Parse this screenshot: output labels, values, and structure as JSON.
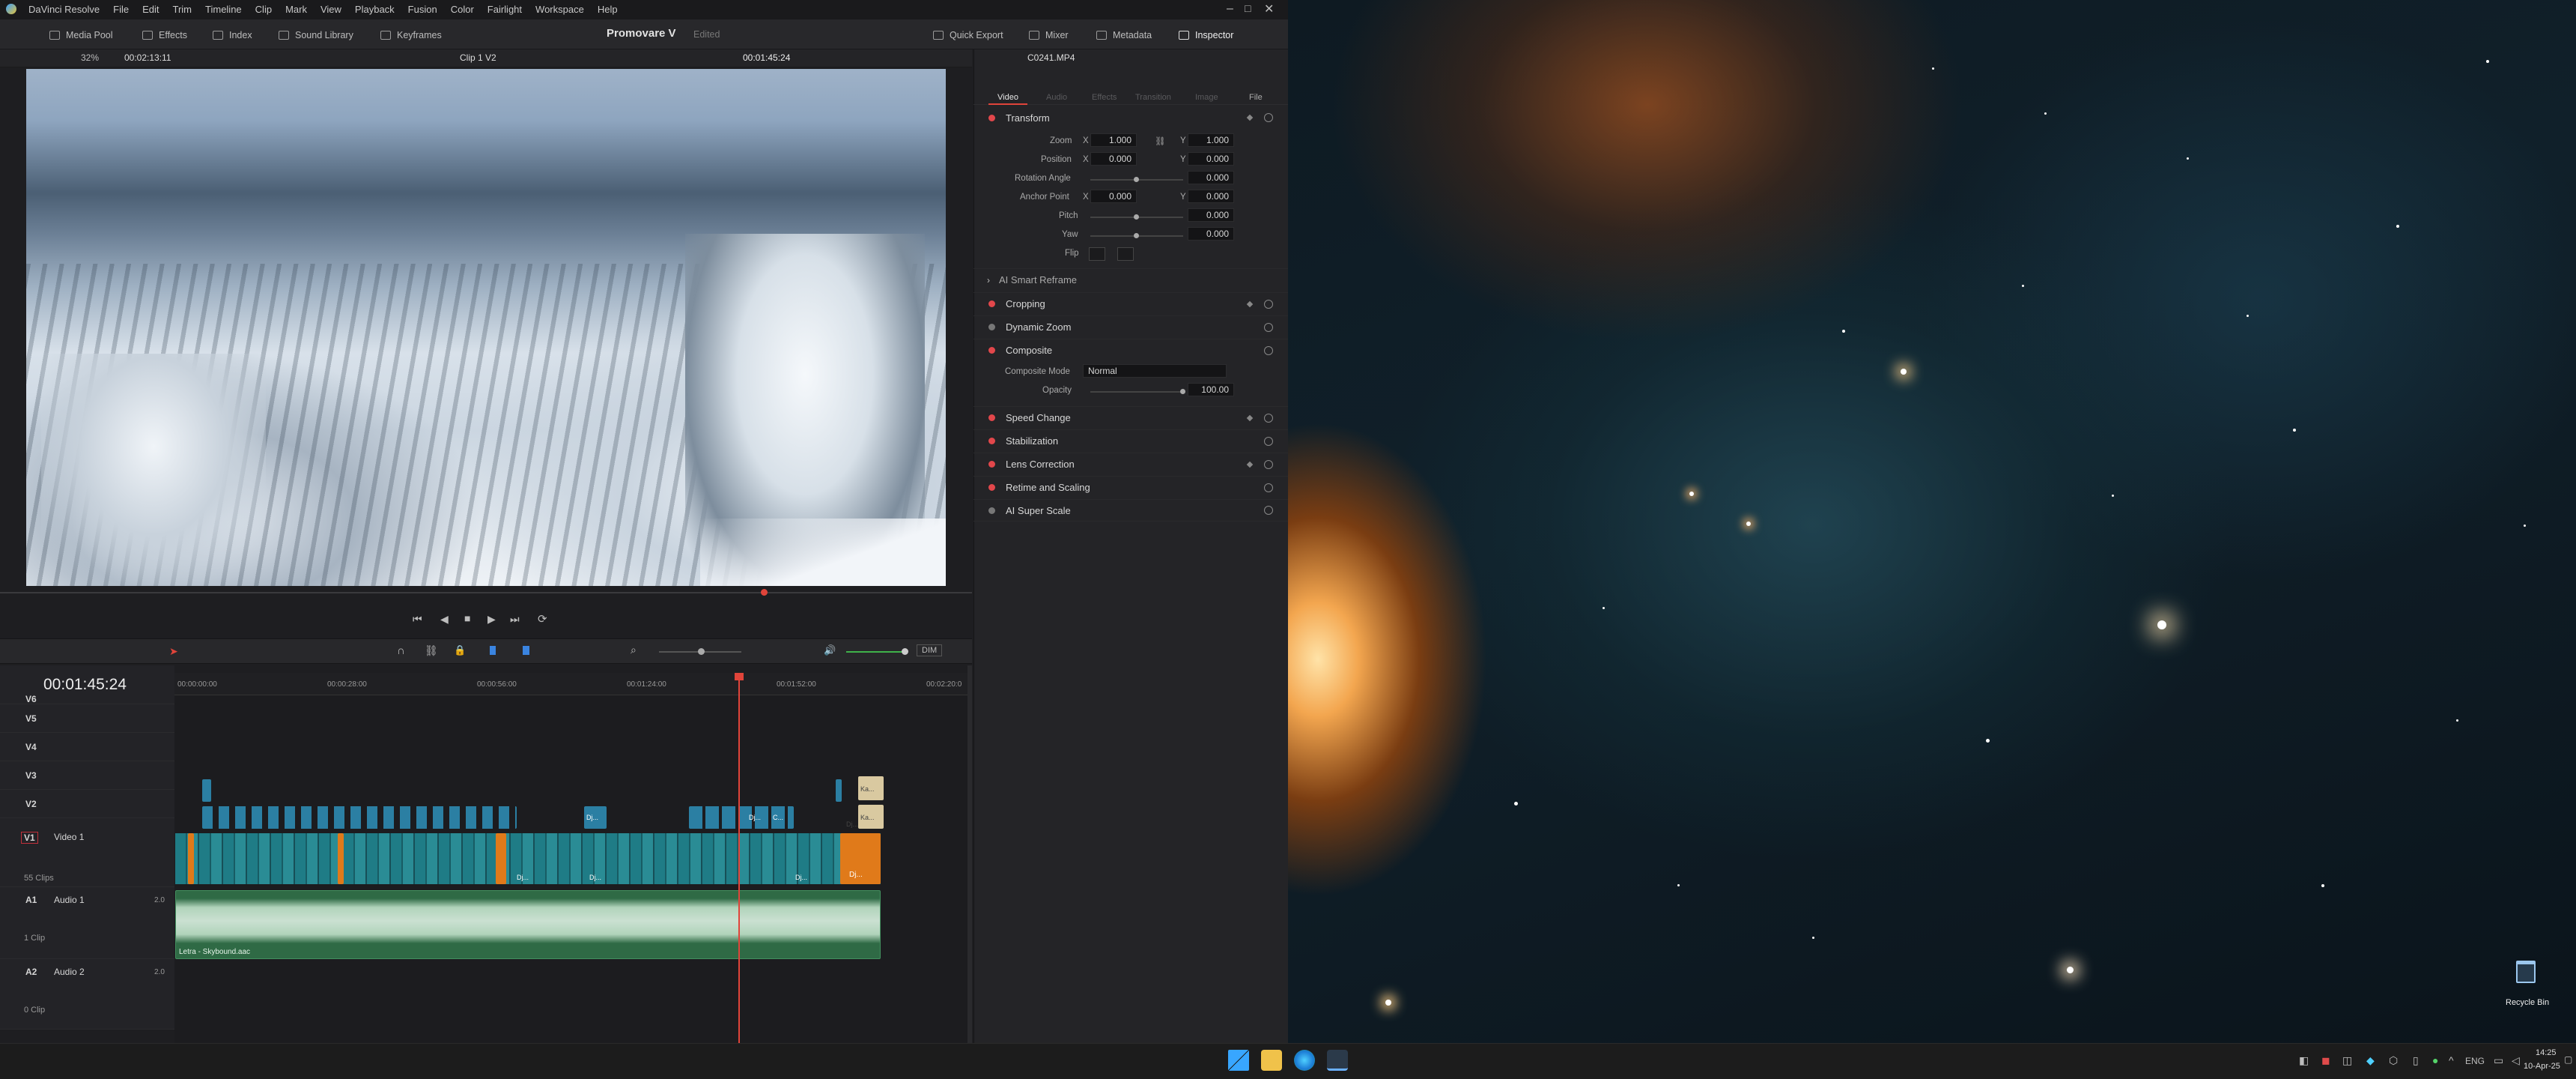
{
  "app": {
    "name": "DaVinci Resolve",
    "menu": [
      "File",
      "Edit",
      "Trim",
      "Timeline",
      "Clip",
      "Mark",
      "View",
      "Playback",
      "Fusion",
      "Color",
      "Fairlight",
      "Workspace",
      "Help"
    ]
  },
  "toolbar": {
    "media_pool": "Media Pool",
    "effects": "Effects",
    "index": "Index",
    "sound_library": "Sound Library",
    "keyframes": "Keyframes",
    "project_name": "Promovare V",
    "project_status": "Edited",
    "quick_export": "Quick Export",
    "mixer": "Mixer",
    "metadata": "Metadata",
    "inspector": "Inspector"
  },
  "viewer": {
    "zoom": "32%",
    "source_tc": "00:02:13:11",
    "clip_label": "Clip 1 V2",
    "timecode": "00:01:45:24"
  },
  "inspector": {
    "clip_name": "C0241.MP4",
    "tabs": [
      "Video",
      "Audio",
      "Effects",
      "Transition",
      "Image",
      "File"
    ],
    "transform": {
      "title": "Transform",
      "zoom_label": "Zoom",
      "zoom_x": "1.000",
      "zoom_y": "1.000",
      "position_label": "Position",
      "pos_x": "0.000",
      "pos_y": "0.000",
      "rotation_label": "Rotation Angle",
      "rotation": "0.000",
      "anchor_label": "Anchor Point",
      "anchor_x": "0.000",
      "anchor_y": "0.000",
      "pitch_label": "Pitch",
      "pitch": "0.000",
      "yaw_label": "Yaw",
      "yaw": "0.000",
      "flip_label": "Flip",
      "x": "X",
      "y": "Y"
    },
    "ai_smart_reframe": "AI Smart Reframe",
    "sections": [
      "Cropping",
      "Dynamic Zoom",
      "Composite"
    ],
    "composite": {
      "mode_label": "Composite Mode",
      "mode": "Normal",
      "opacity_label": "Opacity",
      "opacity": "100.00"
    },
    "sections2": [
      "Speed Change",
      "Stabilization",
      "Lens Correction",
      "Retime and Scaling",
      "AI Super Scale"
    ]
  },
  "timeline": {
    "timecode": "00:01:45:24",
    "dim": "DIM",
    "ruler": [
      "00:00:00:00",
      "00:00:28:00",
      "00:00:56:00",
      "00:01:24:00",
      "00:01:52:00",
      "00:02:20:0"
    ],
    "tracks": [
      {
        "id": "V6",
        "name": ""
      },
      {
        "id": "V5",
        "name": ""
      },
      {
        "id": "V4",
        "name": ""
      },
      {
        "id": "V3",
        "name": ""
      },
      {
        "id": "V2",
        "name": ""
      },
      {
        "id": "V1",
        "name": "Video 1",
        "clips": "55 Clips"
      },
      {
        "id": "A1",
        "name": "Audio 1",
        "vol": "2.0",
        "clips": "1 Clip"
      },
      {
        "id": "A2",
        "name": "Audio 2",
        "vol": "2.0",
        "clips": "0 Clip"
      }
    ],
    "audio_clip": "Letra - Skybound.aac",
    "clip_labels": [
      "Dj...",
      "Dj...",
      "C...",
      "Dj...",
      "Dj...",
      "Ka...",
      "Ka...",
      "Dj...",
      "Dj...",
      "Dj..."
    ]
  },
  "desktop": {
    "recycle_bin": "Recycle Bin"
  },
  "taskbar": {
    "lang": "ENG",
    "time": "14:25",
    "date": "10-Apr-25"
  }
}
